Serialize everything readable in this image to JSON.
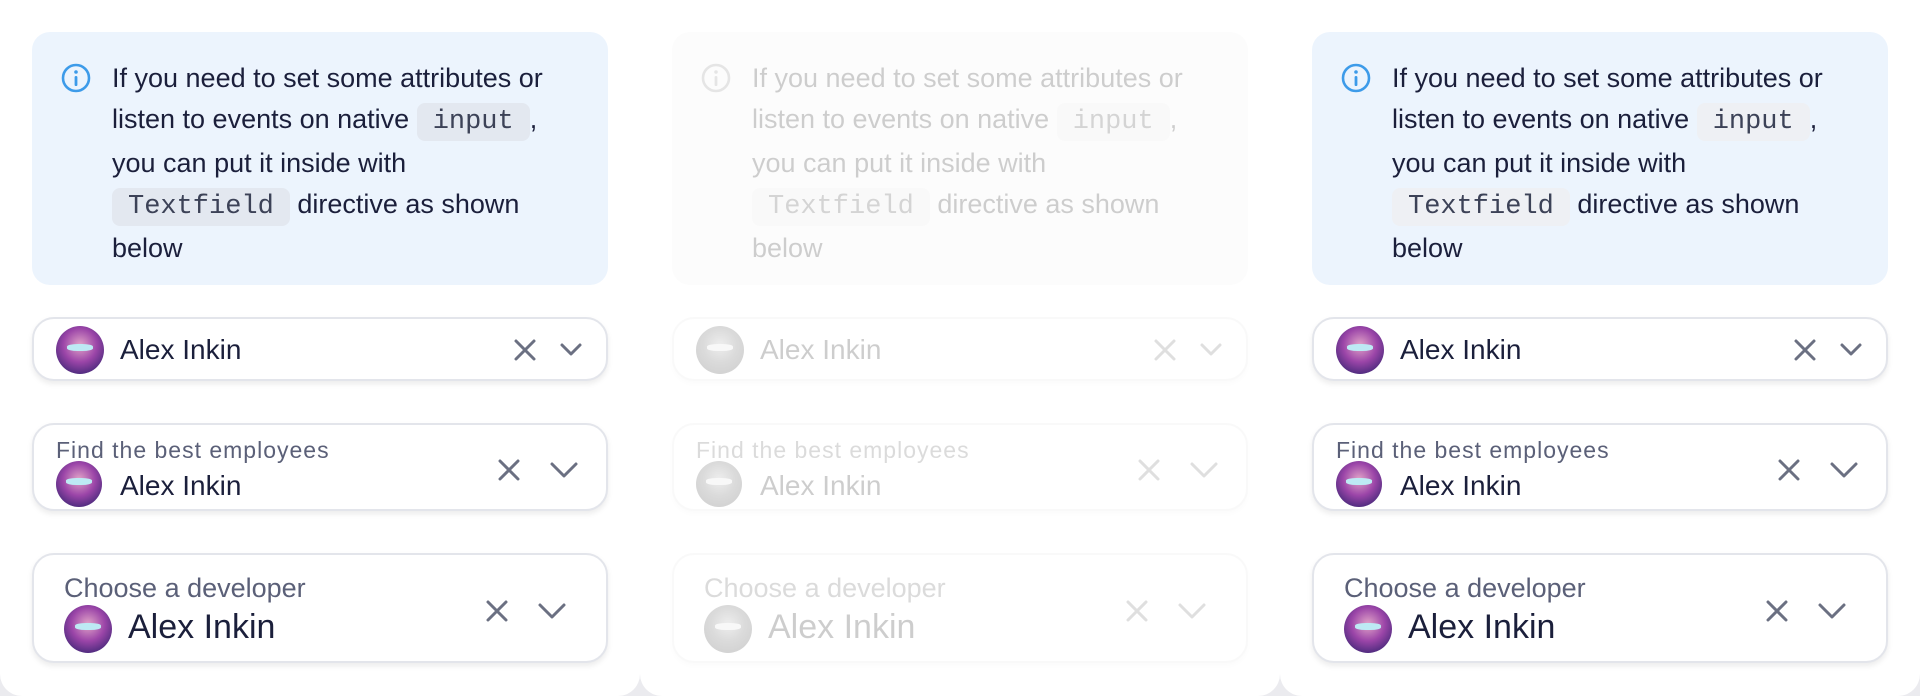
{
  "columns": [
    {
      "variant": "normal",
      "notification": {
        "text_1": "If you need to set some attributes or listen to events on native",
        "code_1": "input",
        "text_2": ", you can put it inside with",
        "code_2": "Textfield",
        "text_3": "directive as shown below"
      },
      "field_small": {
        "value": "Alex Inkin"
      },
      "field_medium": {
        "label": "Find the best employees",
        "value": "Alex Inkin"
      },
      "field_large": {
        "label": "Choose a developer",
        "value": "Alex Inkin"
      }
    },
    {
      "variant": "disabled",
      "notification": {
        "text_1": "If you need to set some attributes or listen to events on native",
        "code_1": "input",
        "text_2": ", you can put it inside with",
        "code_2": "Textfield",
        "text_3": "directive as shown below"
      },
      "field_small": {
        "value": "Alex Inkin"
      },
      "field_medium": {
        "label": "Find the best employees",
        "value": "Alex Inkin"
      },
      "field_large": {
        "label": "Choose a developer",
        "value": "Alex Inkin"
      }
    },
    {
      "variant": "normal",
      "notification": {
        "text_1": "If you need to set some attributes or listen to events on native",
        "code_1": "input",
        "text_2": ", you can put it inside with",
        "code_2": "Textfield",
        "text_3": "directive as shown below"
      },
      "field_small": {
        "value": "Alex Inkin"
      },
      "field_medium": {
        "label": "Find the best employees",
        "value": "Alex Inkin"
      },
      "field_large": {
        "label": "Choose a developer",
        "value": "Alex Inkin"
      }
    }
  ],
  "icons": {
    "info": "info-circle-icon",
    "clear": "close-icon",
    "expand": "chevron-down-icon"
  },
  "colors": {
    "notification_bg": "#ecf4fd",
    "info_accent": "#3d9be9",
    "text": "#1b1f3b",
    "label": "#5b6078",
    "icon_gray": "#6b7082"
  }
}
